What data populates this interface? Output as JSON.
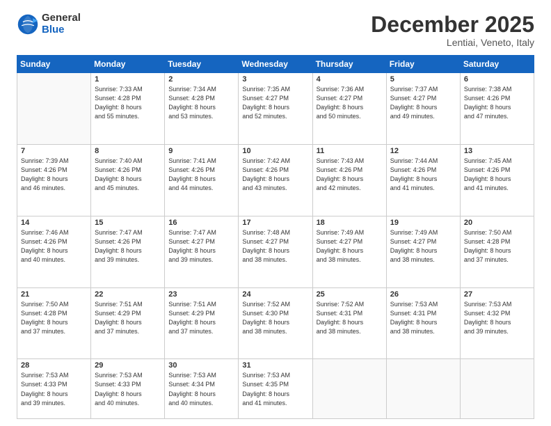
{
  "logo": {
    "general": "General",
    "blue": "Blue"
  },
  "title": {
    "month": "December 2025",
    "location": "Lentiai, Veneto, Italy"
  },
  "days_header": [
    "Sunday",
    "Monday",
    "Tuesday",
    "Wednesday",
    "Thursday",
    "Friday",
    "Saturday"
  ],
  "weeks": [
    [
      {
        "num": "",
        "info": ""
      },
      {
        "num": "1",
        "info": "Sunrise: 7:33 AM\nSunset: 4:28 PM\nDaylight: 8 hours\nand 55 minutes."
      },
      {
        "num": "2",
        "info": "Sunrise: 7:34 AM\nSunset: 4:28 PM\nDaylight: 8 hours\nand 53 minutes."
      },
      {
        "num": "3",
        "info": "Sunrise: 7:35 AM\nSunset: 4:27 PM\nDaylight: 8 hours\nand 52 minutes."
      },
      {
        "num": "4",
        "info": "Sunrise: 7:36 AM\nSunset: 4:27 PM\nDaylight: 8 hours\nand 50 minutes."
      },
      {
        "num": "5",
        "info": "Sunrise: 7:37 AM\nSunset: 4:27 PM\nDaylight: 8 hours\nand 49 minutes."
      },
      {
        "num": "6",
        "info": "Sunrise: 7:38 AM\nSunset: 4:26 PM\nDaylight: 8 hours\nand 47 minutes."
      }
    ],
    [
      {
        "num": "7",
        "info": "Sunrise: 7:39 AM\nSunset: 4:26 PM\nDaylight: 8 hours\nand 46 minutes."
      },
      {
        "num": "8",
        "info": "Sunrise: 7:40 AM\nSunset: 4:26 PM\nDaylight: 8 hours\nand 45 minutes."
      },
      {
        "num": "9",
        "info": "Sunrise: 7:41 AM\nSunset: 4:26 PM\nDaylight: 8 hours\nand 44 minutes."
      },
      {
        "num": "10",
        "info": "Sunrise: 7:42 AM\nSunset: 4:26 PM\nDaylight: 8 hours\nand 43 minutes."
      },
      {
        "num": "11",
        "info": "Sunrise: 7:43 AM\nSunset: 4:26 PM\nDaylight: 8 hours\nand 42 minutes."
      },
      {
        "num": "12",
        "info": "Sunrise: 7:44 AM\nSunset: 4:26 PM\nDaylight: 8 hours\nand 41 minutes."
      },
      {
        "num": "13",
        "info": "Sunrise: 7:45 AM\nSunset: 4:26 PM\nDaylight: 8 hours\nand 41 minutes."
      }
    ],
    [
      {
        "num": "14",
        "info": "Sunrise: 7:46 AM\nSunset: 4:26 PM\nDaylight: 8 hours\nand 40 minutes."
      },
      {
        "num": "15",
        "info": "Sunrise: 7:47 AM\nSunset: 4:26 PM\nDaylight: 8 hours\nand 39 minutes."
      },
      {
        "num": "16",
        "info": "Sunrise: 7:47 AM\nSunset: 4:27 PM\nDaylight: 8 hours\nand 39 minutes."
      },
      {
        "num": "17",
        "info": "Sunrise: 7:48 AM\nSunset: 4:27 PM\nDaylight: 8 hours\nand 38 minutes."
      },
      {
        "num": "18",
        "info": "Sunrise: 7:49 AM\nSunset: 4:27 PM\nDaylight: 8 hours\nand 38 minutes."
      },
      {
        "num": "19",
        "info": "Sunrise: 7:49 AM\nSunset: 4:27 PM\nDaylight: 8 hours\nand 38 minutes."
      },
      {
        "num": "20",
        "info": "Sunrise: 7:50 AM\nSunset: 4:28 PM\nDaylight: 8 hours\nand 37 minutes."
      }
    ],
    [
      {
        "num": "21",
        "info": "Sunrise: 7:50 AM\nSunset: 4:28 PM\nDaylight: 8 hours\nand 37 minutes."
      },
      {
        "num": "22",
        "info": "Sunrise: 7:51 AM\nSunset: 4:29 PM\nDaylight: 8 hours\nand 37 minutes."
      },
      {
        "num": "23",
        "info": "Sunrise: 7:51 AM\nSunset: 4:29 PM\nDaylight: 8 hours\nand 37 minutes."
      },
      {
        "num": "24",
        "info": "Sunrise: 7:52 AM\nSunset: 4:30 PM\nDaylight: 8 hours\nand 38 minutes."
      },
      {
        "num": "25",
        "info": "Sunrise: 7:52 AM\nSunset: 4:31 PM\nDaylight: 8 hours\nand 38 minutes."
      },
      {
        "num": "26",
        "info": "Sunrise: 7:53 AM\nSunset: 4:31 PM\nDaylight: 8 hours\nand 38 minutes."
      },
      {
        "num": "27",
        "info": "Sunrise: 7:53 AM\nSunset: 4:32 PM\nDaylight: 8 hours\nand 39 minutes."
      }
    ],
    [
      {
        "num": "28",
        "info": "Sunrise: 7:53 AM\nSunset: 4:33 PM\nDaylight: 8 hours\nand 39 minutes."
      },
      {
        "num": "29",
        "info": "Sunrise: 7:53 AM\nSunset: 4:33 PM\nDaylight: 8 hours\nand 40 minutes."
      },
      {
        "num": "30",
        "info": "Sunrise: 7:53 AM\nSunset: 4:34 PM\nDaylight: 8 hours\nand 40 minutes."
      },
      {
        "num": "31",
        "info": "Sunrise: 7:53 AM\nSunset: 4:35 PM\nDaylight: 8 hours\nand 41 minutes."
      },
      {
        "num": "",
        "info": ""
      },
      {
        "num": "",
        "info": ""
      },
      {
        "num": "",
        "info": ""
      }
    ]
  ]
}
